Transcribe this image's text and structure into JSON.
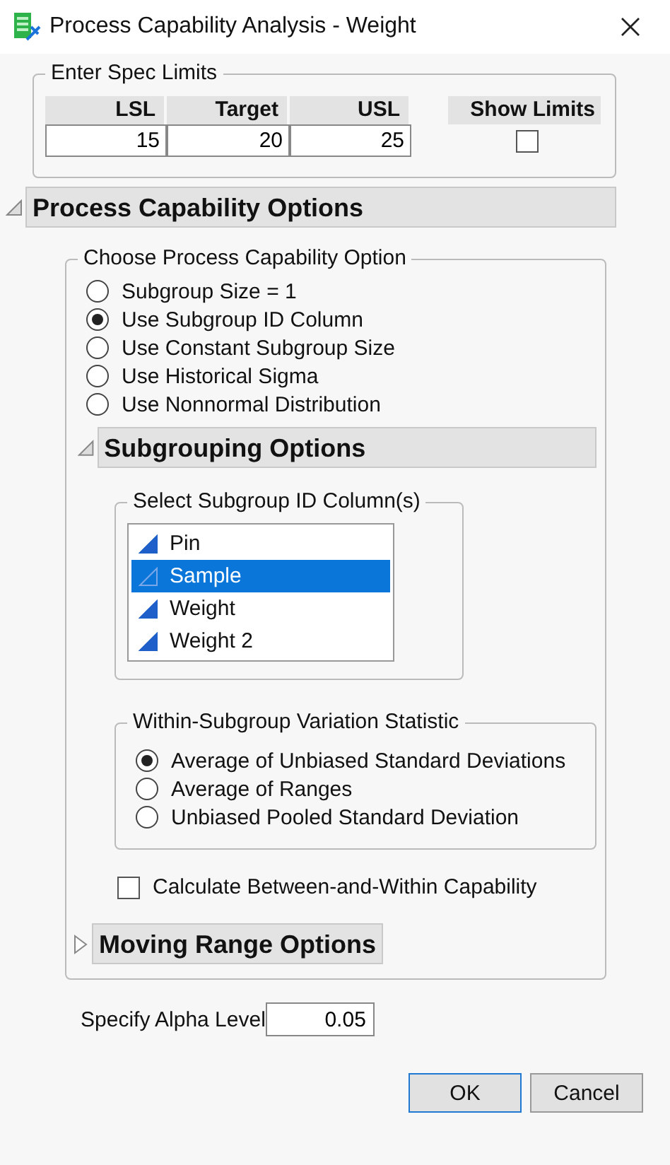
{
  "window": {
    "title": "Process Capability Analysis - Weight"
  },
  "spec_limits": {
    "title": "Enter Spec Limits",
    "columns": [
      "LSL",
      "Target",
      "USL",
      "Show Limits"
    ],
    "values": [
      "15",
      "20",
      "25"
    ],
    "show_limits": false
  },
  "capability_options": {
    "title": "Process Capability Options",
    "expanded": true,
    "choose": {
      "title": "Choose Process Capability Option",
      "options": [
        {
          "label": "Subgroup Size = 1",
          "selected": false
        },
        {
          "label": "Use Subgroup ID Column",
          "selected": true
        },
        {
          "label": "Use Constant Subgroup Size",
          "selected": false
        },
        {
          "label": "Use Historical Sigma",
          "selected": false
        },
        {
          "label": "Use Nonnormal Distribution",
          "selected": false
        }
      ]
    },
    "subgrouping": {
      "title": "Subgrouping Options",
      "expanded": true,
      "column_list": {
        "title": "Select Subgroup ID Column(s)",
        "items": [
          {
            "label": "Pin",
            "selected": false
          },
          {
            "label": "Sample",
            "selected": true
          },
          {
            "label": "Weight",
            "selected": false
          },
          {
            "label": "Weight 2",
            "selected": false
          }
        ]
      },
      "statistic": {
        "title": "Within-Subgroup Variation Statistic",
        "options": [
          {
            "label": "Average of Unbiased Standard Deviations",
            "selected": true
          },
          {
            "label": "Average of Ranges",
            "selected": false
          },
          {
            "label": "Unbiased Pooled Standard Deviation",
            "selected": false
          }
        ]
      },
      "between_within": {
        "label": "Calculate Between-and-Within Capability",
        "checked": false
      }
    },
    "moving_range": {
      "title": "Moving Range Options",
      "expanded": false
    }
  },
  "alpha": {
    "label": "Specify Alpha Level",
    "value": "0.05"
  },
  "buttons": [
    {
      "label": "OK",
      "default": true
    },
    {
      "label": "Cancel",
      "default": false
    }
  ]
}
